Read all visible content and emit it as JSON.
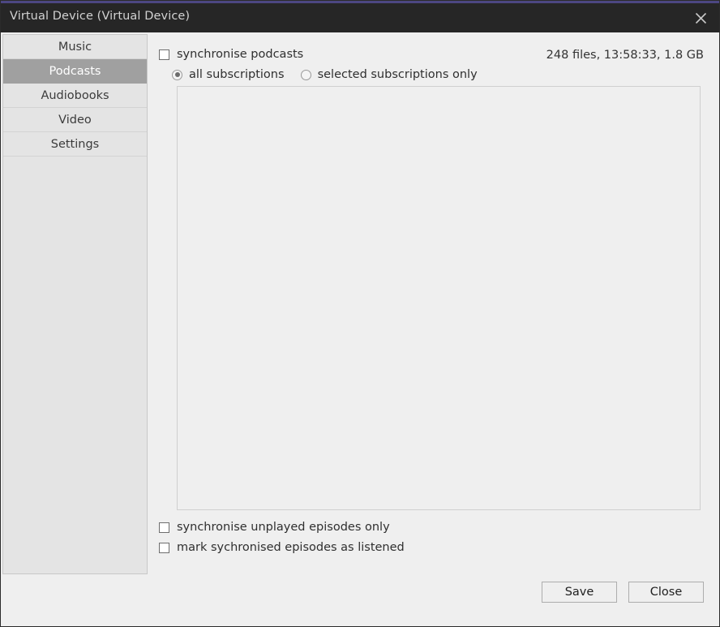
{
  "window": {
    "title": "Virtual Device (Virtual Device)",
    "close_icon": "close-icon",
    "accent_color": "#4c4782",
    "titlebar_color": "#262626",
    "background_color": "#efefef"
  },
  "sidebar": {
    "items": [
      {
        "label": "Music",
        "selected": false
      },
      {
        "label": "Podcasts",
        "selected": true
      },
      {
        "label": "Audiobooks",
        "selected": false
      },
      {
        "label": "Video",
        "selected": false
      },
      {
        "label": "Settings",
        "selected": false
      }
    ],
    "selected_color": "#a0a0a0"
  },
  "main": {
    "sync_checkbox": {
      "label": "synchronise podcasts",
      "checked": false
    },
    "summary": "248 files, 13:58:33, 1.8 GB",
    "scope_radios": [
      {
        "label": "all subscriptions",
        "selected": true
      },
      {
        "label": "selected subscriptions only",
        "selected": false
      }
    ],
    "subscription_list": {
      "items": []
    },
    "options": [
      {
        "label": "synchronise unplayed episodes only",
        "checked": false
      },
      {
        "label": "mark sychronised episodes as listened",
        "checked": false
      }
    ]
  },
  "footer": {
    "save_label": "Save",
    "close_label": "Close"
  }
}
